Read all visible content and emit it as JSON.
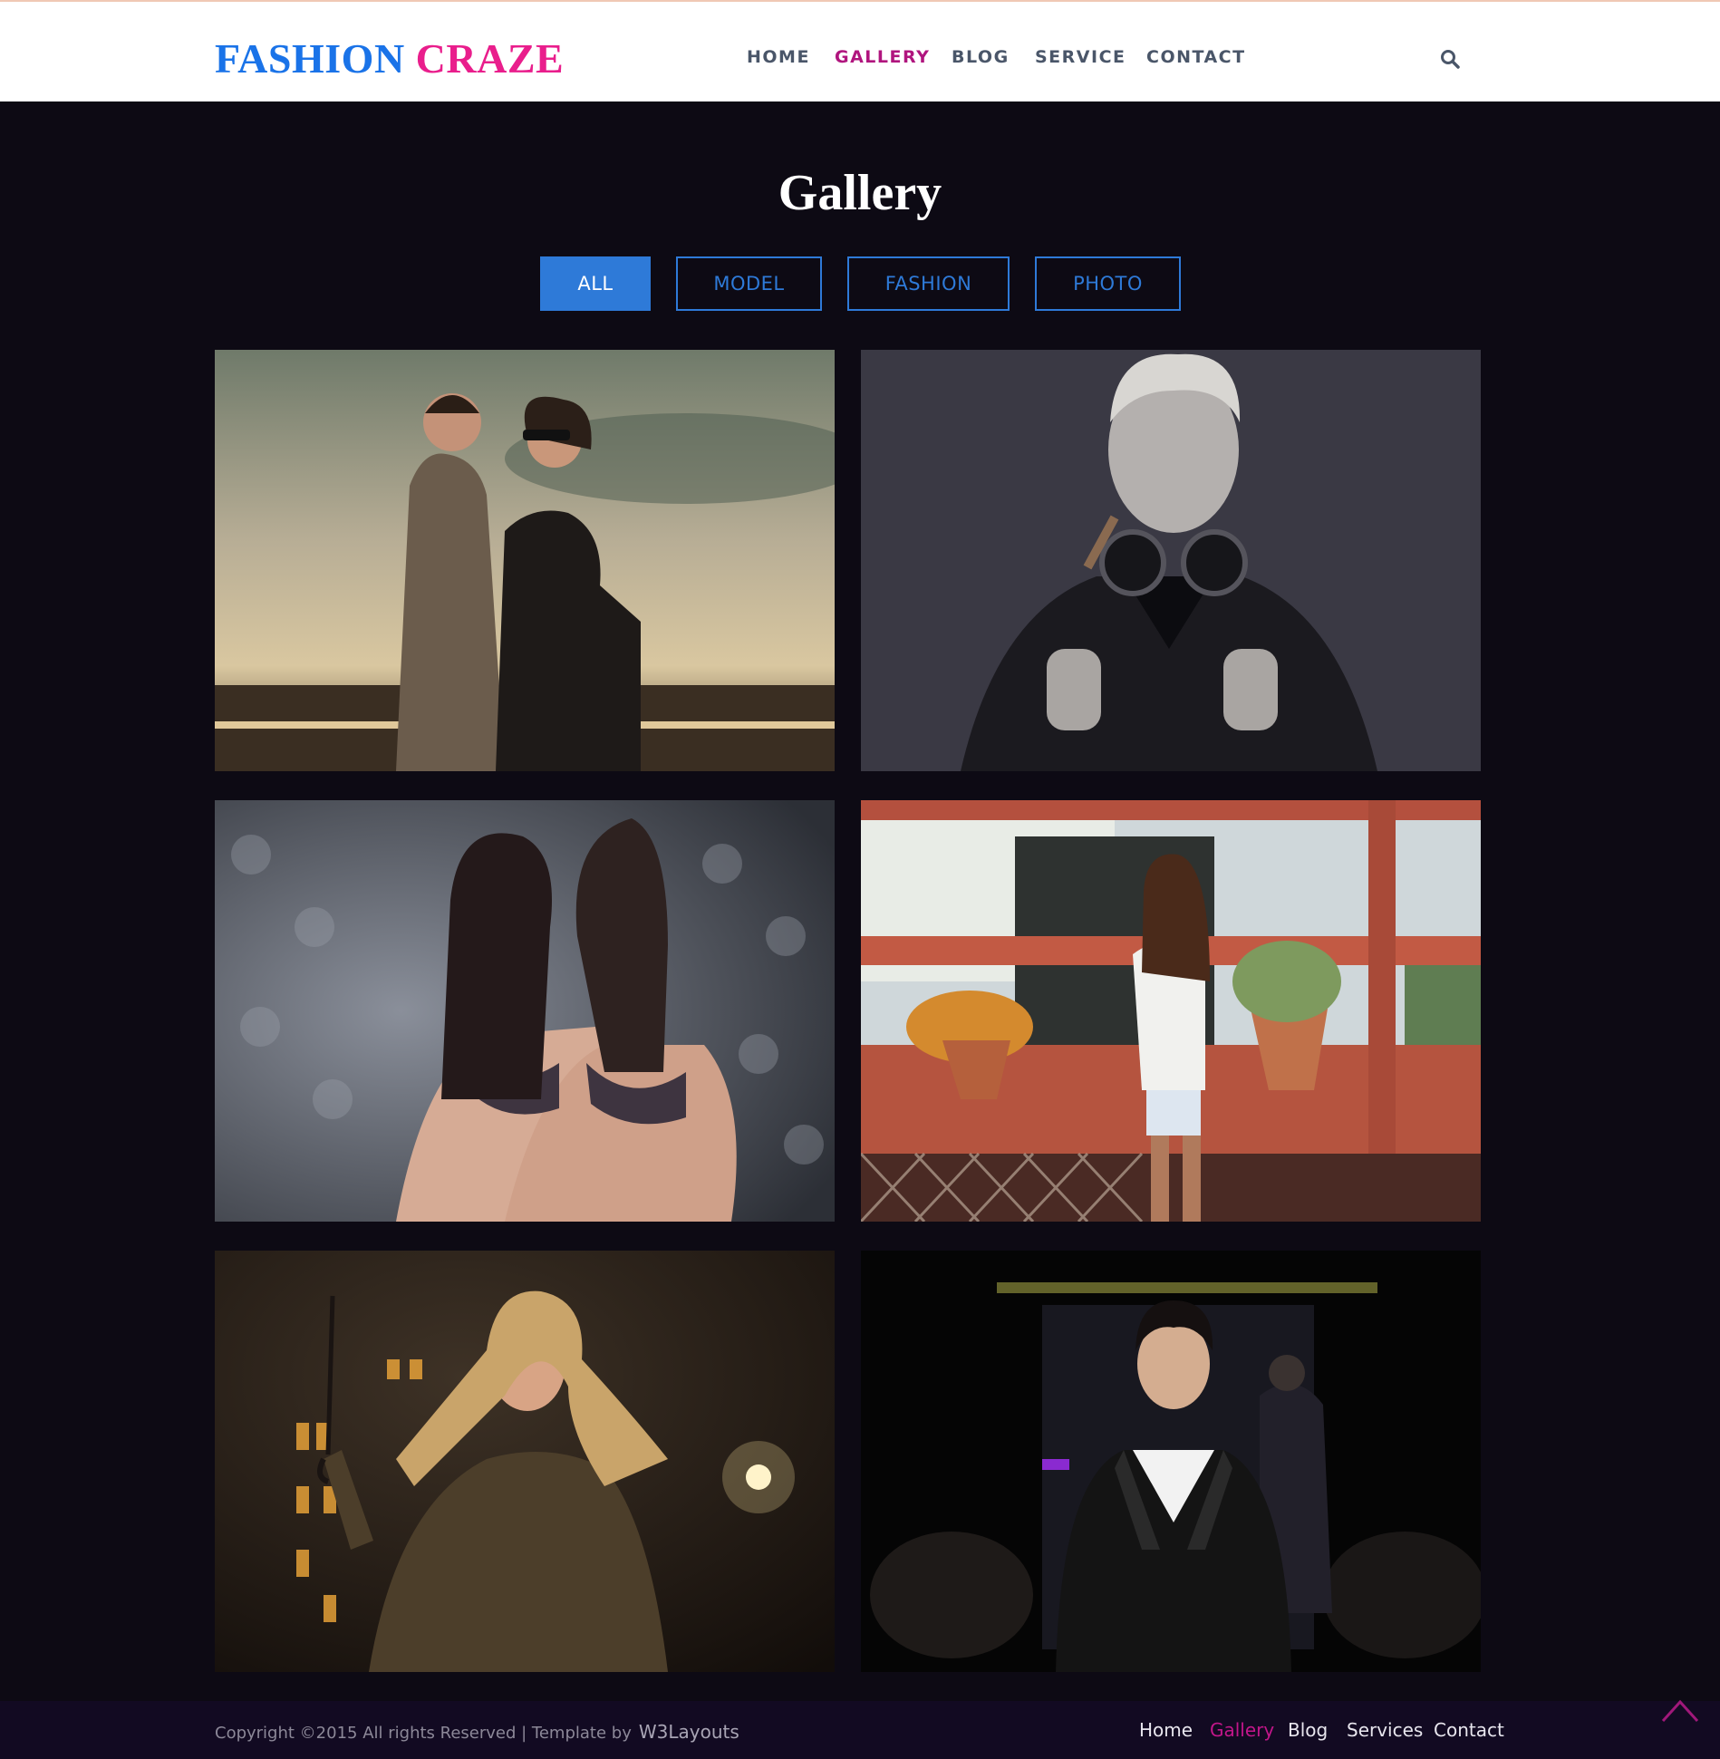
{
  "header": {
    "logo_word1": "FASHION",
    "logo_word2": "CRAZE",
    "nav": [
      "HOME",
      "GALLERY",
      "BLOG",
      "SERVICE",
      "CONTACT"
    ],
    "active_nav": "GALLERY",
    "search_icon": "search-icon"
  },
  "page_title": "Gallery",
  "filters": [
    "ALL",
    "MODEL",
    "FASHION",
    "PHOTO"
  ],
  "active_filter": "ALL",
  "gallery": [
    {
      "name": "couple-sunglasses-photo"
    },
    {
      "name": "man-headphones-photo"
    },
    {
      "name": "two-women-photo"
    },
    {
      "name": "woman-porch-photo"
    },
    {
      "name": "woman-umbrella-photo"
    },
    {
      "name": "man-runway-photo"
    }
  ],
  "footer": {
    "copyright": "Copyright ©2015 All rights Reserved | Template by",
    "credit": "W3Layouts",
    "links": [
      "Home",
      "Gallery",
      "Blog",
      "Services",
      "Contact"
    ],
    "active_link": "Gallery",
    "back_to_top_icon": "chevron-up-icon"
  },
  "colors": {
    "background": "#0d0a14",
    "logo_blue": "#1a73e8",
    "logo_pink": "#e91e8c",
    "accent_blue": "#2e7ad8",
    "active_magenta": "#b0157e",
    "footer_bg": "#120a22"
  }
}
